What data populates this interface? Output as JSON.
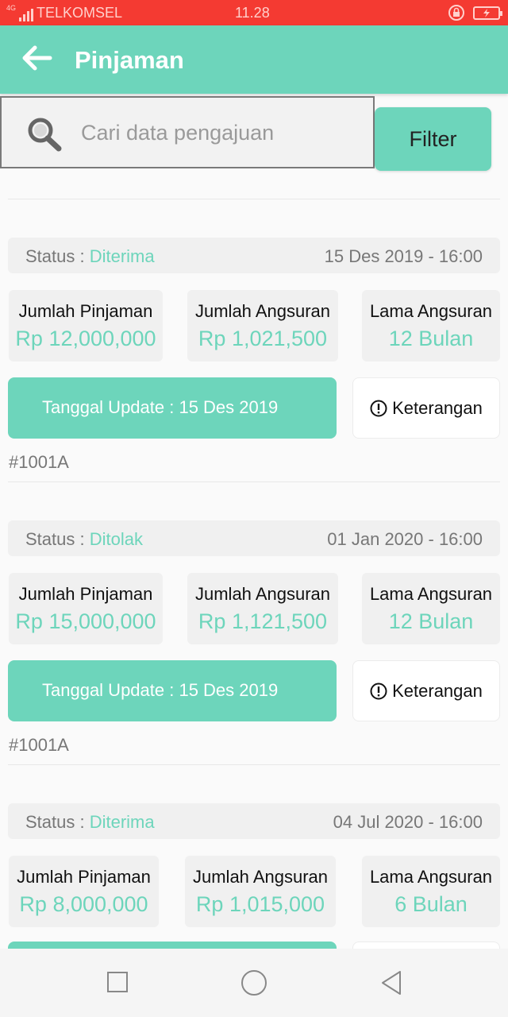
{
  "statusbar": {
    "network": "4G",
    "carrier": "TELKOMSEL",
    "time": "11.28"
  },
  "header": {
    "title": "Pinjaman"
  },
  "search": {
    "placeholder": "Cari data pengajuan",
    "filter_label": "Filter"
  },
  "labels": {
    "status": "Status : ",
    "jumlah_pinjaman": "Jumlah Pinjaman",
    "jumlah_angsuran": "Jumlah Angsuran",
    "lama_angsuran": "Lama Angsuran",
    "keterangan": "Keterangan"
  },
  "cards": [
    {
      "status": "Diterima",
      "date": "15 Des 2019 - 16:00",
      "jumlah_pinjaman": "Rp 12,000,000",
      "jumlah_angsuran": "Rp 1,021,500",
      "lama_angsuran": "12 Bulan",
      "update": "Tanggal Update : 15 Des 2019",
      "id": "#1001A"
    },
    {
      "status": "Ditolak",
      "date": "01 Jan 2020 - 16:00",
      "jumlah_pinjaman": "Rp 15,000,000",
      "jumlah_angsuran": "Rp 1,121,500",
      "lama_angsuran": "12 Bulan",
      "update": "Tanggal Update : 15 Des 2019",
      "id": "#1001A"
    },
    {
      "status": "Diterima",
      "date": "04 Jul 2020 - 16:00",
      "jumlah_pinjaman": "Rp 8,000,000",
      "jumlah_angsuran": "Rp 1,015,000",
      "lama_angsuran": "6 Bulan",
      "update": "",
      "id": ""
    }
  ],
  "colors": {
    "accent": "#6dd5bb",
    "statusbar": "#f43a32"
  }
}
